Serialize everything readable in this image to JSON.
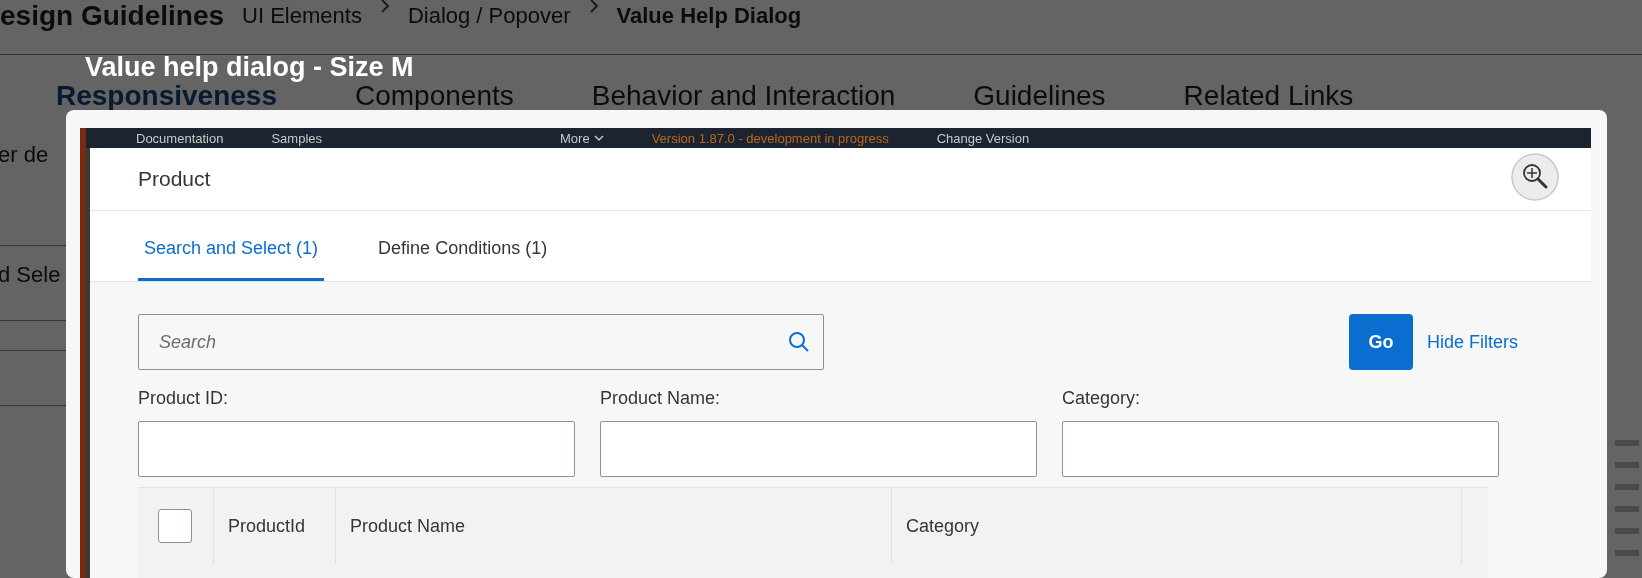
{
  "background_page": {
    "site_title": "esign Guidelines",
    "breadcrumb": [
      "UI Elements",
      "Dialog / Popover"
    ],
    "breadcrumb_current": "Value Help Dialog",
    "tabs": [
      {
        "label": "Responsiveness",
        "selected": true
      },
      {
        "label": "Components",
        "selected": false
      },
      {
        "label": "Behavior and Interaction",
        "selected": false
      },
      {
        "label": "Guidelines",
        "selected": false
      },
      {
        "label": "Related Links",
        "selected": false
      }
    ],
    "text_fragments": [
      "er de",
      "d Sele"
    ]
  },
  "lightbox": {
    "caption": "Value help dialog - Size M",
    "image": {
      "header_links": [
        "Documentation",
        "Samples",
        "More"
      ],
      "version": "Version 1.87.0 - development in progress",
      "change_version": "Change Version",
      "dialog": {
        "title": "Product",
        "tabs": [
          {
            "label": "Search and Select (1)",
            "selected": true
          },
          {
            "label": "Define Conditions (1)",
            "selected": false
          }
        ],
        "search": {
          "placeholder": "Search"
        },
        "go_button": "Go",
        "hide_filters": "Hide Filters",
        "filters": [
          {
            "label": "Product ID:"
          },
          {
            "label": "Product Name:"
          },
          {
            "label": "Category:"
          }
        ],
        "table": {
          "select_all": {
            "checked": false
          },
          "columns": [
            "ProductId",
            "Product Name",
            "Category"
          ]
        }
      }
    }
  }
}
